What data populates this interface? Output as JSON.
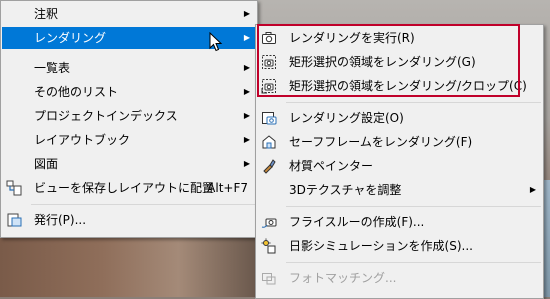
{
  "main_menu": {
    "items": [
      {
        "label": "注釈",
        "has_submenu": true
      },
      {
        "label": "レンダリング",
        "has_submenu": true,
        "selected": true
      },
      {
        "label": "一覧表",
        "has_submenu": true
      },
      {
        "label": "その他のリスト",
        "has_submenu": true
      },
      {
        "label": "プロジェクトインデックス",
        "has_submenu": true
      },
      {
        "label": "レイアウトブック",
        "has_submenu": true
      },
      {
        "label": "図面",
        "has_submenu": true
      },
      {
        "label": "ビューを保存しレイアウトに配置",
        "shortcut": "Alt+F7",
        "icon": "save-view-to-layout-icon"
      },
      {
        "label": "発行(P)...",
        "icon": "publish-icon"
      }
    ]
  },
  "sub_menu": {
    "items": [
      {
        "label": "レンダリングを実行(R)",
        "icon": "camera-render-icon"
      },
      {
        "label": "矩形選択の領域をレンダリング(G)",
        "icon": "render-marquee-icon"
      },
      {
        "label": "矩形選択の領域をレンダリング/クロップ(C)",
        "icon": "render-crop-icon"
      },
      {
        "label": "レンダリング設定(O)",
        "icon": "render-settings-icon"
      },
      {
        "label": "セーフフレームをレンダリング(F)",
        "icon": "safe-frame-icon"
      },
      {
        "label": "材質ペインター",
        "icon": "material-painter-icon"
      },
      {
        "label": "3Dテクスチャを調整",
        "has_submenu": true
      },
      {
        "label": "フライスルーの作成(F)...",
        "icon": "fly-through-icon"
      },
      {
        "label": "日影シミュレーションを作成(S)...",
        "icon": "sun-study-icon"
      },
      {
        "label": "フォトマッチング...",
        "icon": "photo-matching-icon",
        "disabled": true
      }
    ]
  },
  "arrow_glyph": "▶",
  "colors": {
    "selection": "#0078d7",
    "highlight_border": "#c0002a",
    "menu_bg": "#f0f0f0",
    "disabled_text": "#a0a0a0"
  }
}
